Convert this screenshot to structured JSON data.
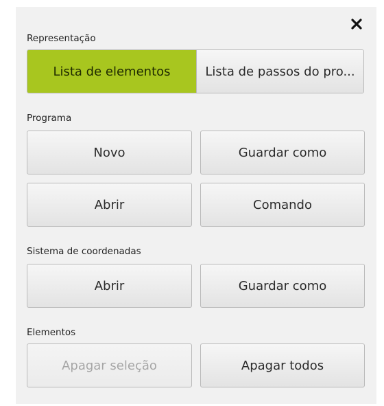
{
  "close_label": "✕",
  "representacao": {
    "label": "Representação",
    "options": [
      "Lista de elementos",
      "Lista de passos do pro..."
    ],
    "selected_index": 0
  },
  "programa": {
    "label": "Programa",
    "novo": "Novo",
    "guardar_como": "Guardar como",
    "abrir": "Abrir",
    "comando": "Comando"
  },
  "sistema_coordenadas": {
    "label": "Sistema de coordenadas",
    "abrir": "Abrir",
    "guardar_como": "Guardar como"
  },
  "elementos": {
    "label": "Elementos",
    "apagar_selecao": "Apagar seleção",
    "apagar_selecao_enabled": false,
    "apagar_todos": "Apagar todos"
  },
  "colors": {
    "accent": "#a8c61f",
    "panel": "#f1f1f1"
  }
}
